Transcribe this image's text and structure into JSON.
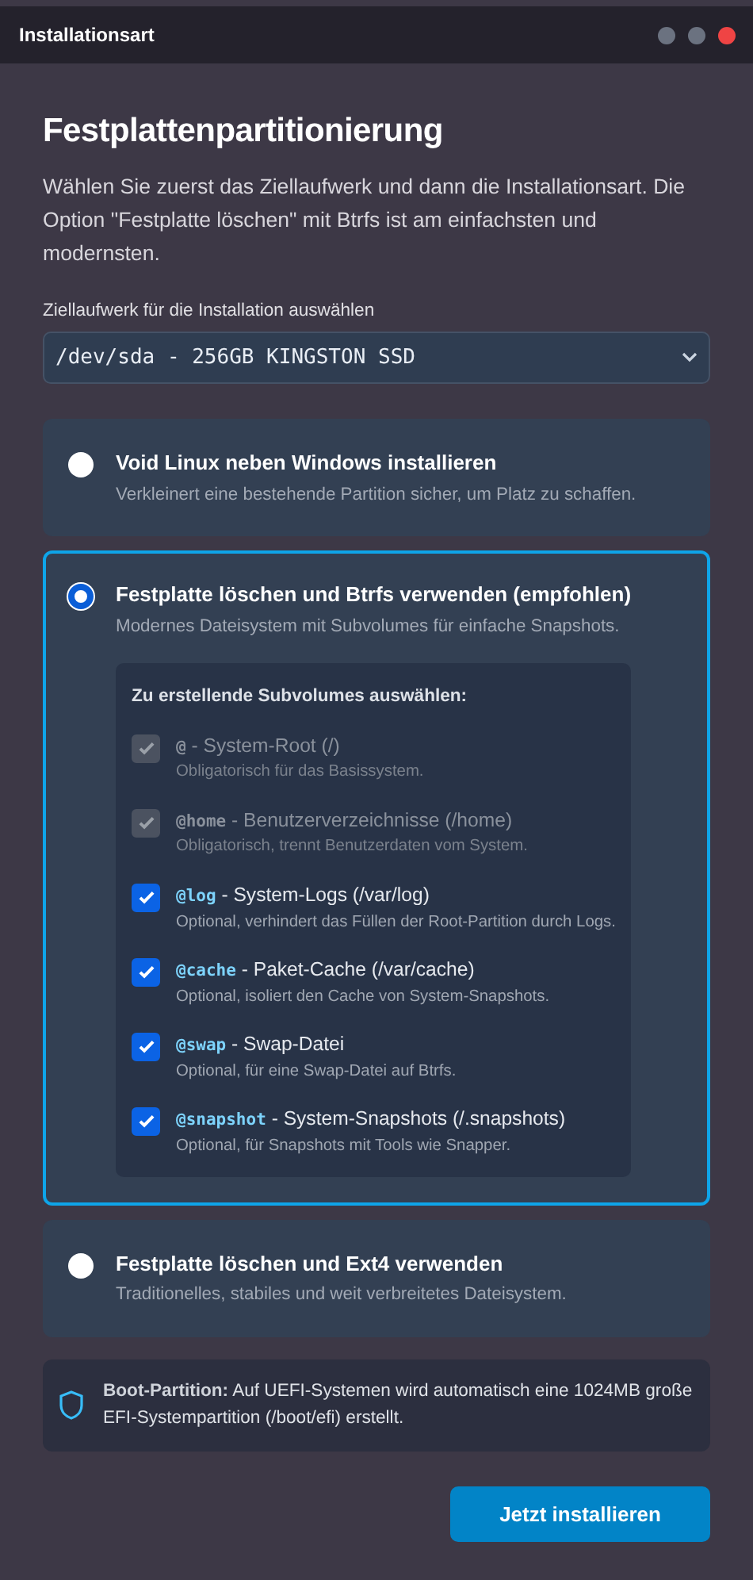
{
  "window": {
    "title": "Installationsart"
  },
  "heading": "Festplattenpartitionierung",
  "intro": "Wählen Sie zuerst das Ziellaufwerk und dann die Installationsart. Die Option \"Festplatte löschen\" mit Btrfs ist am einfachsten und modernsten.",
  "drive": {
    "label": "Ziellaufwerk für die Installation auswählen",
    "value": "/dev/sda - 256GB KINGSTON SSD"
  },
  "options": [
    {
      "title": "Void Linux neben Windows installieren",
      "description": "Verkleinert eine bestehende Partition sicher, um Platz zu schaffen.",
      "selected": false
    },
    {
      "title": "Festplatte löschen und Btrfs verwenden (empfohlen)",
      "description": "Modernes Dateisystem mit Subvolumes für einfache Snapshots.",
      "selected": true,
      "subvolumes": {
        "title": "Zu erstellende Subvolumes auswählen:",
        "items": [
          {
            "code": "@",
            "label": "- System-Root (/)",
            "description": "Obligatorisch für das Basissystem.",
            "checked": true,
            "disabled": true
          },
          {
            "code": "@home",
            "label": "- Benutzerverzeichnisse (/home)",
            "description": "Obligatorisch, trennt Benutzerdaten vom System.",
            "checked": true,
            "disabled": true
          },
          {
            "code": "@log",
            "label": "- System-Logs (/var/log)",
            "description": "Optional, verhindert das Füllen der Root-Partition durch Logs.",
            "checked": true,
            "disabled": false
          },
          {
            "code": "@cache",
            "label": "- Paket-Cache (/var/cache)",
            "description": "Optional, isoliert den Cache von System-Snapshots.",
            "checked": true,
            "disabled": false
          },
          {
            "code": "@swap",
            "label": "- Swap-Datei",
            "description": "Optional, für eine Swap-Datei auf Btrfs.",
            "checked": true,
            "disabled": false
          },
          {
            "code": "@snapshot",
            "label": "- System-Snapshots (/.snapshots)",
            "description": "Optional, für Snapshots mit Tools wie Snapper.",
            "checked": true,
            "disabled": false
          }
        ]
      }
    },
    {
      "title": "Festplatte löschen und Ext4 verwenden",
      "description": "Traditionelles, stabiles und weit verbreitetes Dateisystem.",
      "selected": false
    }
  ],
  "note": "**Boot-Partition:** Auf UEFI-Systemen wird automatisch eine 1024MB große EFI-Systempartition (/boot/efi) erstellt.",
  "install_button": "Jetzt installieren"
}
